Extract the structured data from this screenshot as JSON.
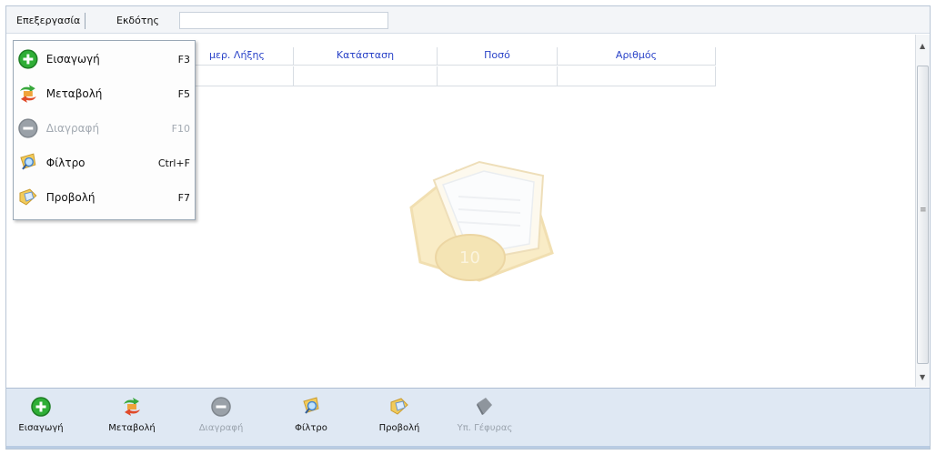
{
  "menubar": {
    "items": [
      {
        "label": "Επεξεργασία"
      },
      {
        "label": "Εκδότης"
      }
    ],
    "search_value": ""
  },
  "grid": {
    "columns": [
      "μερ. Λήξης",
      "Κατάσταση",
      "Ποσό",
      "Αριθμός"
    ],
    "rows": [
      [
        "",
        "",
        "",
        ""
      ]
    ]
  },
  "dropdown": {
    "items": [
      {
        "label": "Εισαγωγή",
        "shortcut": "F3",
        "icon": "add-icon",
        "enabled": true
      },
      {
        "label": "Μεταβολή",
        "shortcut": "F5",
        "icon": "edit-icon",
        "enabled": true
      },
      {
        "label": "Διαγραφή",
        "shortcut": "F10",
        "icon": "delete-icon",
        "enabled": false
      },
      {
        "label": "Φίλτρο",
        "shortcut": "Ctrl+F",
        "icon": "filter-icon",
        "enabled": true
      },
      {
        "label": "Προβολή",
        "shortcut": "F7",
        "icon": "view-icon",
        "enabled": true
      }
    ]
  },
  "toolbar": {
    "buttons": [
      {
        "label": "Εισαγωγή",
        "icon": "add-icon",
        "enabled": true
      },
      {
        "label": "Μεταβολή",
        "icon": "edit-icon",
        "enabled": true
      },
      {
        "label": "Διαγραφή",
        "icon": "delete-icon",
        "enabled": false
      },
      {
        "label": "Φίλτρο",
        "icon": "filter-icon",
        "enabled": true
      },
      {
        "label": "Προβολή",
        "icon": "view-icon",
        "enabled": true
      },
      {
        "label": "Υπ. Γέφυρας",
        "icon": "bridge-icon",
        "enabled": false
      }
    ]
  },
  "watermark": {
    "text": "10",
    "icon": "checkbook-icon"
  },
  "colors": {
    "header_text": "#2a43c8",
    "toolbar_bg": "#dfe8f3",
    "add_green": "#2fae36",
    "disabled_gray": "#8e959d",
    "watermark_gold": "#e3b23c"
  }
}
